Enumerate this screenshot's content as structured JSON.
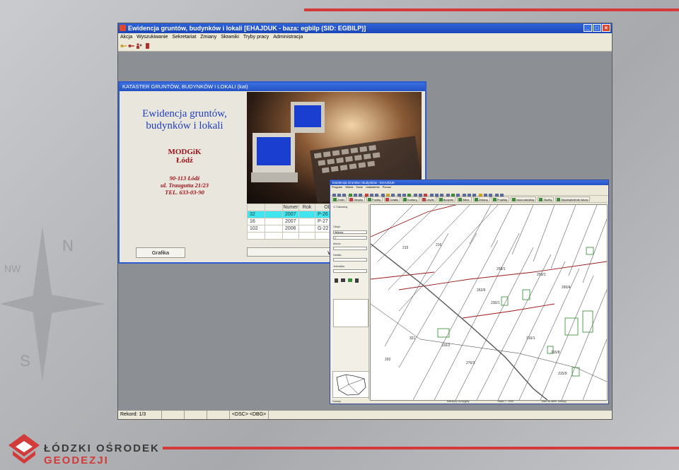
{
  "branding": {
    "org_line1": "ŁÓDZKI OŚRODEK",
    "org_line2": "GEODEZJI"
  },
  "app": {
    "title": "Ewidencja gruntów, budynków i lokali [EHAJDUK - baza: egbilp (SID: EGBILP)]",
    "menu": [
      "Akcja",
      "Wyszukiwanie",
      "Sekretariat",
      "Zmiany",
      "Słowniki",
      "Tryby pracy",
      "Administracja"
    ],
    "status": {
      "record": "Rekord: 1/3",
      "keys": "<DSC> <DBG>"
    }
  },
  "kataster": {
    "title": "KATASTER GRUNTÓW, BUDYNKÓW I LOKALI (kat)",
    "heading_line1": "Ewidencja gruntów,",
    "heading_line2": "budynków i lokali",
    "org_line1": "MODGiK",
    "org_line2": "Łódź",
    "addr_line1": "90-113 Łódź",
    "addr_line2": "ul. Traugutta 21/23",
    "addr_line3": "TEL. 633-03-90",
    "table": {
      "headers": [
        "Numer",
        "Rok",
        "Obręb"
      ],
      "rows": [
        [
          "32",
          "2007",
          "P-26"
        ],
        [
          "16",
          "2007",
          "P-27"
        ],
        [
          "102",
          "2006",
          "G-22"
        ],
        [
          "",
          "",
          ""
        ]
      ],
      "selected_row": 0
    },
    "grafika_label": "Grafika",
    "exit_label": "Wy"
  },
  "gis": {
    "title": "Ewidencja Gruntów i Budynków - EHAJDUK",
    "menu": [
      "Program",
      "Widok",
      "Dane",
      "Ustawienia",
      "Pomoc"
    ],
    "tabs": [
      "Zmiel",
      "Obręby",
      "Punkty",
      "Działki",
      "Kontury",
      "Użytki",
      "Budynki",
      "Wlice",
      "Zmiany",
      "Projekty",
      "baza wanstwy",
      "Służby",
      "Wyodrębnienie lokow"
    ],
    "left_panel": {
      "checkbox_label": "Odświeżaj",
      "fields": [
        {
          "label": "Obręb",
          "value": "Widzew"
        },
        {
          "label": "",
          "value": "1"
        },
        {
          "label": "Arkusz",
          "value": ""
        },
        {
          "label": "Działka",
          "value": ""
        },
        {
          "label": "Jednostka",
          "value": ""
        }
      ]
    },
    "status": [
      "Gotowy",
      "Mierzymy na wyjęby",
      "Skala 1 : 1000",
      "Stan na dzień: bieżący"
    ]
  },
  "map_labels": [
    "215",
    "216",
    "258/1",
    "259/1",
    "260/4",
    "262/6",
    "230/1",
    "316/1",
    "315/8",
    "315/9",
    "316/2",
    "276/3",
    "321",
    "293"
  ]
}
